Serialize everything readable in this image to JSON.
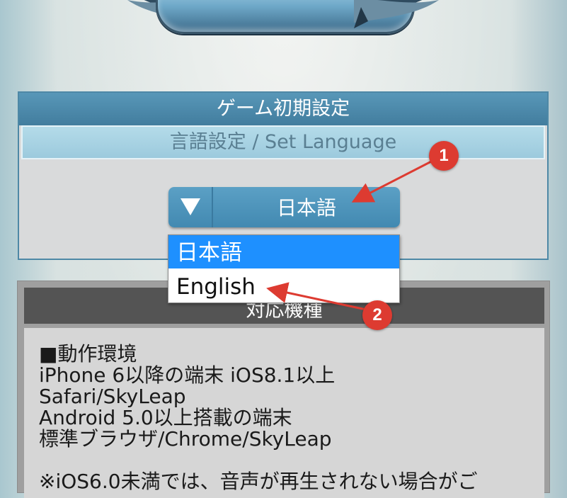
{
  "logo": {
    "title": "",
    "icon": "game-logo-banner"
  },
  "settings": {
    "header": "ゲーム初期設定",
    "subheader": "言語設定 / Set Language",
    "select": {
      "value": "日本語",
      "arrow_icon": "triangle-down-icon"
    },
    "dropdown": {
      "options": [
        "日本語",
        "English"
      ],
      "selected_index": 0,
      "highlight_color": "#1e90ff"
    }
  },
  "devices": {
    "header": "対応機種",
    "lines": [
      "■動作環境",
      "iPhone 6以降の端末 iOS8.1以上",
      "Safari/SkyLeap",
      "Android 5.0以上搭載の端末",
      "標準ブラウザ/Chrome/SkyLeap",
      "",
      "※iOS6.0未満では、音声が再生されない場合がご"
    ]
  },
  "annotations": {
    "badge_color": "#dd3b31",
    "badges": [
      "1",
      "2"
    ]
  },
  "colors": {
    "panel_blue": "#4e88a6",
    "subheader_blue": "#9ccadd",
    "devices_header": "#545454"
  }
}
